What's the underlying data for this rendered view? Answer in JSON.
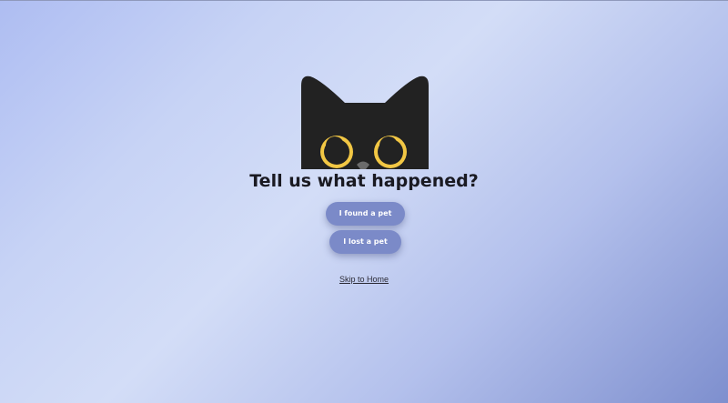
{
  "prompt": {
    "title": "Tell us what happened?"
  },
  "actions": {
    "found_label": "I found a pet",
    "lost_label": "I lost a pet"
  },
  "links": {
    "skip_label": "Skip to Home"
  },
  "illustration": {
    "icon": "black-cat-peeking-icon",
    "colors": {
      "fur": "#222222",
      "eyes": "#f2c744",
      "nose": "#6b6b6b"
    }
  },
  "colors": {
    "button": "#7b8ac8",
    "button_text": "#ffffff",
    "title_text": "#1a1a22"
  }
}
